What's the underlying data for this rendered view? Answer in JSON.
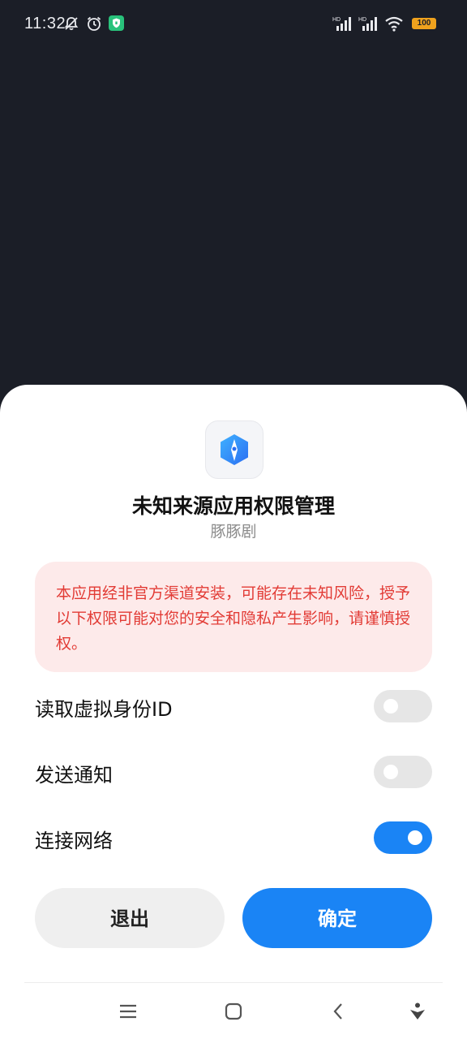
{
  "status_bar": {
    "time": "11:32",
    "battery": "100",
    "icons": [
      "bell-muted-icon",
      "alarm-icon",
      "security-app-icon",
      "signal-hd-icon",
      "signal-hd-icon",
      "wifi-icon",
      "battery-icon"
    ]
  },
  "dialog": {
    "title": "未知来源应用权限管理",
    "app_name": "豚豚剧",
    "warning": "本应用经非官方渠道安装，可能存在未知风险，授予以下权限可能对您的安全和隐私产生影响，请谨慎授权。",
    "permissions": [
      {
        "label": "读取虚拟身份ID",
        "enabled": false
      },
      {
        "label": "发送通知",
        "enabled": false
      },
      {
        "label": "连接网络",
        "enabled": true
      }
    ],
    "exit_label": "退出",
    "confirm_label": "确定"
  },
  "colors": {
    "accent": "#1a84f5",
    "warning_text": "#e23b35",
    "warning_bg": "#fdeaea",
    "backdrop": "#1b1e27"
  },
  "nav_bar": {
    "icons": [
      "menu-icon",
      "home-icon",
      "back-icon",
      "assistant-icon"
    ]
  }
}
